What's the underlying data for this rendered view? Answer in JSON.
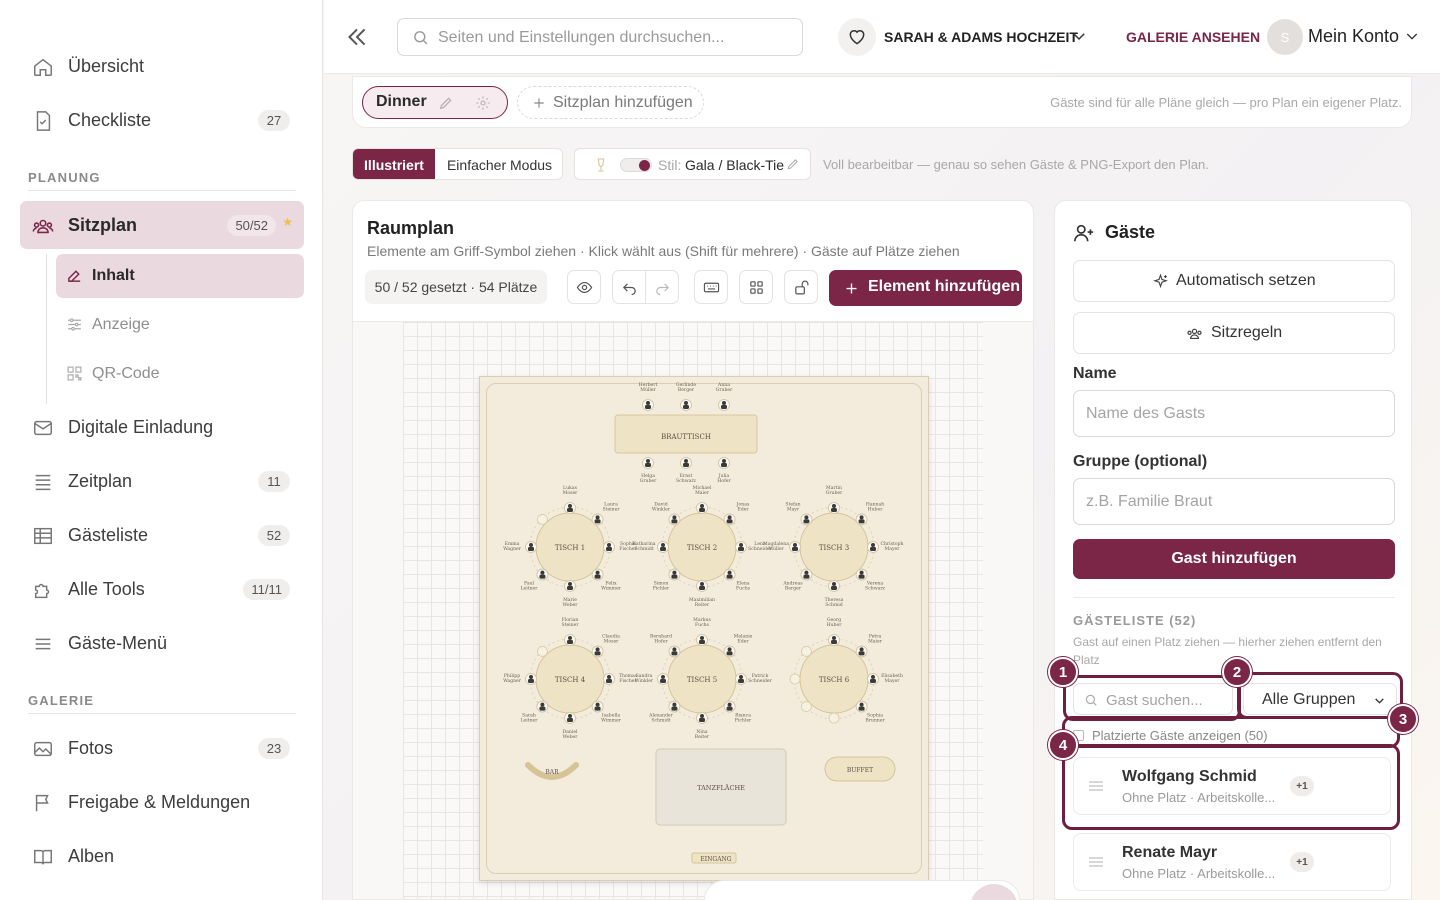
{
  "sidebar": {
    "items_top": [
      {
        "label": "Übersicht",
        "icon": "home-icon"
      },
      {
        "label": "Checkliste",
        "icon": "checklist-icon",
        "count": "27"
      }
    ],
    "section_planning": "PLANUNG",
    "seating": {
      "label": "Sitzplan",
      "icon": "people-icon",
      "count": "50/52",
      "star": "★"
    },
    "sub_items": [
      {
        "label": "Inhalt",
        "icon": "edit-icon"
      },
      {
        "label": "Anzeige",
        "icon": "sliders-icon"
      },
      {
        "label": "QR-Code",
        "icon": "qr-icon"
      }
    ],
    "items_mid": [
      {
        "label": "Digitale Einladung",
        "icon": "mail-icon"
      },
      {
        "label": "Zeitplan",
        "icon": "list-icon",
        "count": "11"
      },
      {
        "label": "Gästeliste",
        "icon": "table-icon",
        "count": "52"
      },
      {
        "label": "Alle Tools",
        "icon": "puzzle-icon",
        "count": "11/11"
      },
      {
        "label": "Gäste-Menü",
        "icon": "menu-icon"
      }
    ],
    "section_gallery": "GALERIE",
    "items_gallery": [
      {
        "label": "Fotos",
        "icon": "image-icon",
        "count": "23"
      },
      {
        "label": "Freigabe & Meldungen",
        "icon": "flag-icon"
      },
      {
        "label": "Alben",
        "icon": "book-icon"
      }
    ]
  },
  "topbar": {
    "search_placeholder": "Seiten und Einstellungen durchsuchen...",
    "event_name": "SARAH & ADAMS HOCHZEIT",
    "gallery_link": "GALERIE ANSEHEN",
    "avatar_letter": "S",
    "account_label": "Mein Konto"
  },
  "plans": {
    "active_tab": "Dinner",
    "add_plan": "Sitzplan hinzufügen",
    "hint": "Gäste sind für alle Pläne gleich — pro Plan ein eigener Platz."
  },
  "mode": {
    "illustrated": "Illustriert",
    "simple": "Einfacher Modus",
    "style_prefix": "Stil:",
    "style_value": "Gala / Black-Tie",
    "hint": "Voll bearbeitbar — genau so sehen Gäste & PNG-Export den Plan."
  },
  "room": {
    "title": "Raumplan",
    "subtitle": "Elemente am Griff-Symbol ziehen · Klick wählt aus (Shift für mehrere) · Gäste auf Plätze ziehen",
    "count": "50 / 52 gesetzt · 54 Plätze",
    "add_element": "Element hinzufügen",
    "head_table": {
      "label": "BRAUTTISCH",
      "top_guests": [
        "Herbert Müller",
        "Gerlinde Berger",
        "Anna Gruber"
      ],
      "bottom_guests": [
        "Helga Gruber",
        "Ernst Schwarz",
        "Julia Hofer"
      ]
    },
    "tables": [
      {
        "label": "TISCH 1",
        "guests": [
          "Lukas Moser",
          "Laura Steiner",
          "Sophie Fischer",
          "Felix Wimmer",
          "Marie Weber",
          "Paul Leitner",
          "Emma Wagner"
        ]
      },
      {
        "label": "TISCH 2",
        "guests": [
          "Michael Maier",
          "Jonas Eder",
          "Lena Schneider",
          "Elena Fuchs",
          "Maximilian Reiter",
          "Simon Pichler",
          "Katharina Schmidt",
          "David Winkler",
          "Tobias Bauer"
        ]
      },
      {
        "label": "TISCH 3",
        "guests": [
          "Martin Gruber",
          "Hannah Huber",
          "Christoph Mayer",
          "Verena Schwarz",
          "Theresa Schmid",
          "Andreas Berger",
          "Magdalena Müller",
          "Stefan Mayr"
        ]
      },
      {
        "label": "TISCH 4",
        "guests": [
          "Florian Steiner",
          "Claudia Moser",
          "Thomas Fischer",
          "Isabella Wimmer",
          "Daniel Weber",
          "Sarah Leitner",
          "Philipp Wagner"
        ]
      },
      {
        "label": "TISCH 5",
        "guests": [
          "Markus Fuchs",
          "Melanie Eder",
          "Patrick Schneider",
          "Bianca Pichler",
          "Nina Reiter",
          "Alexander Schmidt",
          "Sandra Winkler",
          "Bernhard Hofer",
          "Carina Bauer"
        ]
      },
      {
        "label": "TISCH 6",
        "guests": [
          "Georg Huber",
          "Petra Maier",
          "Elisabeth Mayer",
          "Sophia Brunner"
        ]
      }
    ],
    "bar": "BAR",
    "buffet": "BUFFET",
    "dance": "TANZFLÄCHE",
    "entrance": "EINGANG"
  },
  "guests": {
    "title": "Gäste",
    "auto": "Automatisch setzen",
    "rules": "Sitzregeln",
    "name_label": "Name",
    "name_placeholder": "Name des Gasts",
    "group_label": "Gruppe (optional)",
    "group_placeholder": "z.B. Familie Braut",
    "add_button": "Gast hinzufügen",
    "list_head": "GÄSTELISTE (52)",
    "list_hint": "Gast auf einen Platz ziehen — hierher ziehen entfernt den Platz",
    "search_placeholder": "Gast suchen...",
    "filter_value": "Alle Gruppen",
    "placed_toggle": "Platzierte Gäste anzeigen (50)",
    "rows": [
      {
        "name": "Wolfgang Schmid",
        "meta": "Ohne Platz · Arbeitskolle...",
        "plus": "+1"
      },
      {
        "name": "Renate Mayr",
        "meta": "Ohne Platz · Arbeitskolle...",
        "plus": "+1"
      }
    ]
  },
  "annotations": [
    "1",
    "2",
    "3",
    "4"
  ],
  "colors": {
    "accent": "#7b2547",
    "accent_soft": "#ead9de"
  }
}
